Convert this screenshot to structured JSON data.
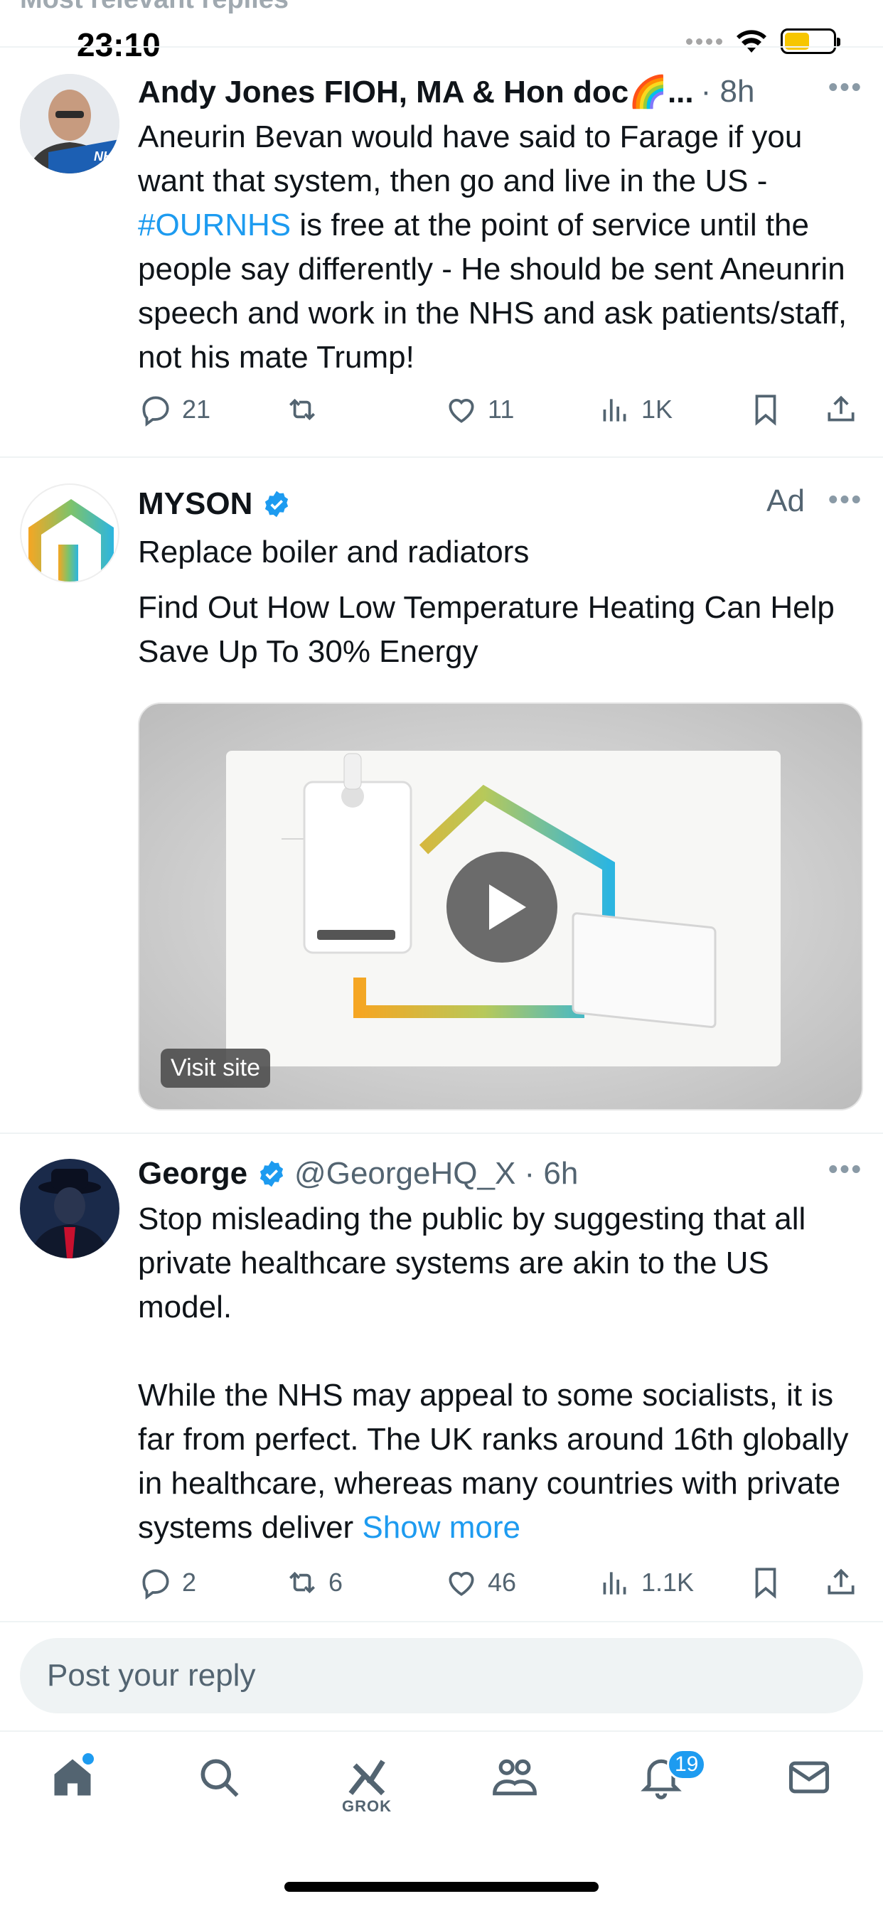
{
  "status_bar": {
    "time": "23:10",
    "header_hint": "Most relevant replies"
  },
  "posts": [
    {
      "name": "Andy Jones FIOH, MA & Hon doc🌈...",
      "meta": "· 8h",
      "text_before": "Aneurin Bevan would have said to Farage if you want that system, then go and live in the US -\n",
      "hashtag": "#OURNHS",
      "text_after": " is free at the point of service until the people say differently - He should be sent Aneunrin speech and work in the NHS and ask patients/staff, not his mate Trump!",
      "avatar_badge": "NHS",
      "replies": "21",
      "reposts": "",
      "likes": "11",
      "views": "1K"
    },
    {
      "name": "MYSON",
      "ad_label": "Ad",
      "headline": "Replace boiler and radiators",
      "text": "Find Out How Low Temperature Heating Can Help Save Up To 30% Energy",
      "visit_label": "Visit site"
    },
    {
      "name": "George",
      "meta": "@GeorgeHQ_X · 6h",
      "text": "Stop misleading the public by suggesting that all private healthcare systems are akin to the US model.\n\nWhile the NHS may appeal to some socialists, it is far from perfect. The UK ranks around 16th globally in healthcare, whereas many countries with private systems deliver ",
      "show_more": "Show more",
      "replies": "2",
      "reposts": "6",
      "likes": "46",
      "views": "1.1K"
    }
  ],
  "reply": {
    "placeholder": "Post your reply"
  },
  "nav": {
    "grok_label": "GROK",
    "notifications_count": "19"
  },
  "colors": {
    "accent": "#1d9bf0",
    "text": "#0f1419",
    "muted": "#536471"
  }
}
